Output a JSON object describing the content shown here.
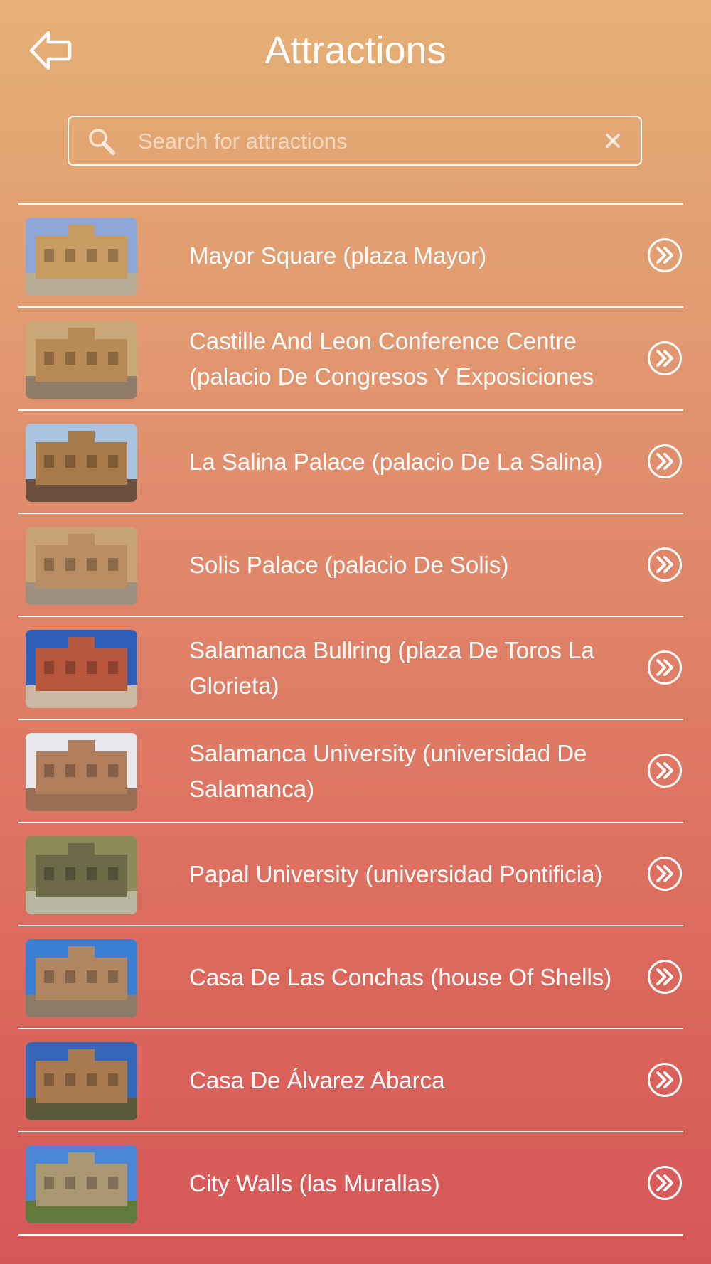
{
  "header": {
    "title": "Attractions",
    "back_icon": "arrow-left-icon"
  },
  "search": {
    "placeholder": "Search for attractions",
    "value": "",
    "icon": "search-icon",
    "clear_icon": "close-icon"
  },
  "colors": {
    "gradient_top": "#e4b176",
    "gradient_bottom": "#d65658",
    "foreground": "#ffffff"
  },
  "attractions": [
    {
      "name": "Mayor Square (plaza Mayor)",
      "thumb": {
        "sky": "#8fa7d6",
        "building": "#c79b62",
        "ground": "#b8ab98"
      }
    },
    {
      "name": "Castille And Leon Conference Centre (palacio De Congresos Y Exposiciones",
      "thumb": {
        "sky": "#c9a777",
        "building": "#b88a56",
        "ground": "#8f7c68"
      }
    },
    {
      "name": "La Salina Palace (palacio De La Salina)",
      "thumb": {
        "sky": "#a9c2e0",
        "building": "#a87a4a",
        "ground": "#6b5040"
      }
    },
    {
      "name": "Solis Palace (palacio De Solis)",
      "thumb": {
        "sky": "#c7a277",
        "building": "#b98e62",
        "ground": "#9e8f80"
      }
    },
    {
      "name": "Salamanca Bullring (plaza De Toros La Glorieta)",
      "thumb": {
        "sky": "#2e5fb8",
        "building": "#b8573e",
        "ground": "#c8b8a4"
      }
    },
    {
      "name": "Salamanca University (universidad De Salamanca)",
      "thumb": {
        "sky": "#e8e8ec",
        "building": "#b07e5c",
        "ground": "#9a6e54"
      }
    },
    {
      "name": "Papal University (universidad Pontificia)",
      "thumb": {
        "sky": "#8f8a5a",
        "building": "#6d6a4a",
        "ground": "#b9b7a2"
      }
    },
    {
      "name": "Casa De Las Conchas (house Of Shells)",
      "thumb": {
        "sky": "#3b7fd4",
        "building": "#b08660",
        "ground": "#8d7b6a"
      }
    },
    {
      "name": "Casa De Álvarez Abarca",
      "thumb": {
        "sky": "#3566b8",
        "building": "#a97a50",
        "ground": "#5a5a3a"
      }
    },
    {
      "name": "City Walls (las Murallas)",
      "thumb": {
        "sky": "#4b86d6",
        "building": "#a99672",
        "ground": "#5f7a3a"
      }
    }
  ]
}
